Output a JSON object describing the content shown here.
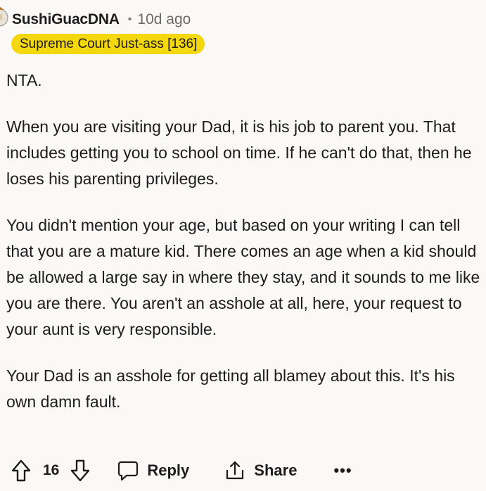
{
  "comment": {
    "username": "SushiGuacDNA",
    "separator": "•",
    "timestamp": "10d ago",
    "flair": "Supreme Court Just-ass [136]",
    "paragraphs": [
      "NTA.",
      "When you are visiting your Dad, it is his job to parent you. That includes getting you to school on time. If he can't do that, then he loses his parenting privileges.",
      "You didn't mention your age, but based on your writing I can tell that you are a mature kid. There comes an age when a kid should be allowed a large say in where they stay, and it sounds to me like you are there. You aren't an asshole at all, here, your request to your aunt is very responsible.",
      "Your Dad is an asshole for getting all blamey about this. It's his own damn fault."
    ]
  },
  "actions": {
    "upvote_icon": "upvote-arrow-icon",
    "score": "16",
    "downvote_icon": "downvote-arrow-icon",
    "reply_icon": "speech-bubble-icon",
    "reply_label": "Reply",
    "share_icon": "share-icon",
    "share_label": "Share",
    "more_label": "•••"
  },
  "colors": {
    "background": "#fbf9f8",
    "flair_background": "#f5d70d",
    "text": "#1c1c1c",
    "muted": "#6a6a6a"
  }
}
